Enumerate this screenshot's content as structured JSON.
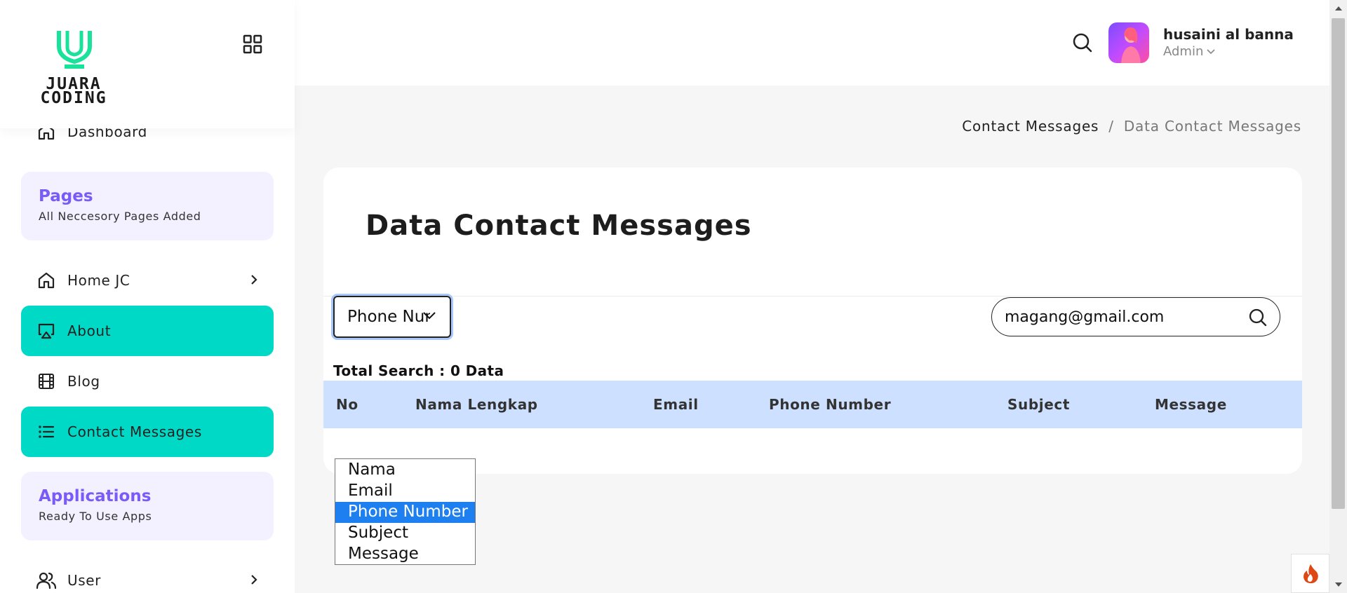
{
  "brand": {
    "line1": "JUARA",
    "line2": "CODING"
  },
  "sidebar": {
    "dashboard": "Dashboard",
    "pages_section": {
      "title": "Pages",
      "subtitle": "All Neccesory Pages Added"
    },
    "items": [
      {
        "label": "Home JC",
        "active": false,
        "has_submenu": true
      },
      {
        "label": "About",
        "active": true
      },
      {
        "label": "Blog",
        "active": false
      },
      {
        "label": "Contact Messages",
        "active": true
      }
    ],
    "apps_section": {
      "title": "Applications",
      "subtitle": "Ready To Use Apps"
    },
    "user_item": {
      "label": "User",
      "has_submenu": true
    }
  },
  "header": {
    "user": {
      "name": "husaini al banna",
      "role": "Admin"
    }
  },
  "breadcrumb": {
    "parent": "Contact Messages",
    "separator": "/",
    "current": "Data Contact Messages"
  },
  "main": {
    "title": "Data Contact Messages",
    "filter": {
      "selected": "Phone Number",
      "options": [
        "Nama",
        "Email",
        "Phone Number",
        "Subject",
        "Message"
      ]
    },
    "search": {
      "value": "magang@gmail.com"
    },
    "total_search": "Total Search : 0 Data",
    "table": {
      "columns": [
        "No",
        "Nama Lengkap",
        "Email",
        "Phone Number",
        "Subject",
        "Message"
      ],
      "rows": []
    }
  },
  "colors": {
    "accent": "#00d9c6",
    "section_bg": "#f3f1ff",
    "section_title": "#7a5af8",
    "table_head": "#cde0ff",
    "option_selected": "#1e7ff0"
  }
}
